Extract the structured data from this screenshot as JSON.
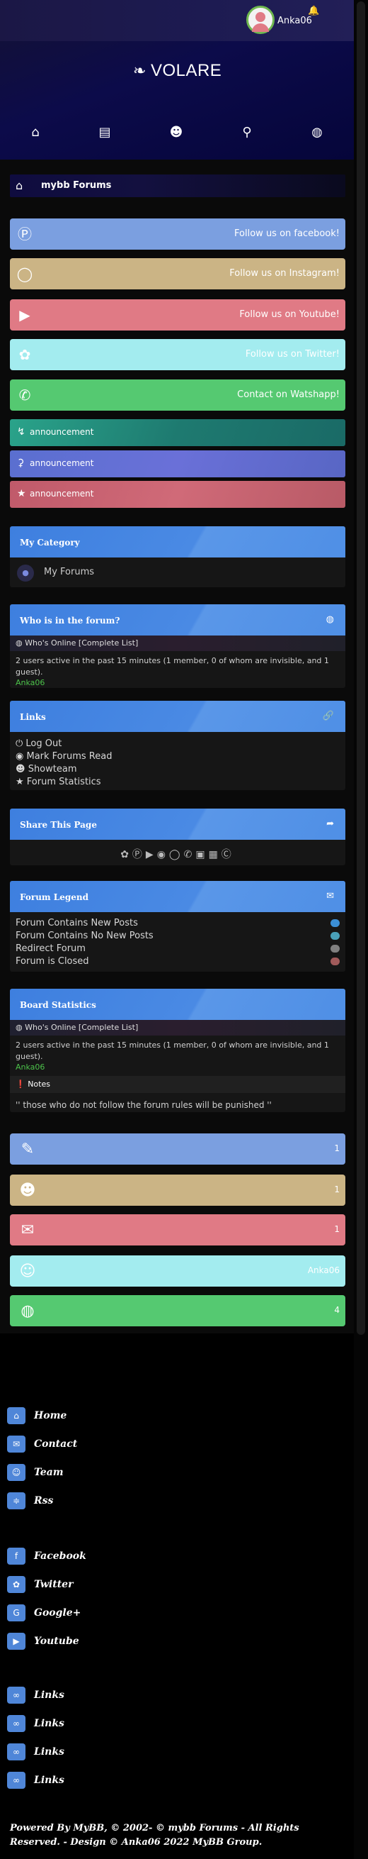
{
  "header": {
    "username": "Anka06",
    "logo_text": "VOLARE",
    "nav": [
      {
        "icon": "home-icon",
        "glyph": "⌂"
      },
      {
        "icon": "chart-icon",
        "glyph": "▤"
      },
      {
        "icon": "users-icon",
        "glyph": "☻"
      },
      {
        "icon": "search-icon",
        "glyph": "⚲"
      },
      {
        "icon": "globe-icon",
        "glyph": "◍"
      }
    ]
  },
  "breadcrumb": {
    "label": "mybb Forums"
  },
  "social": [
    {
      "label": "Follow us on facebook!",
      "icon": "facebook-icon",
      "color": "#7b9fe0"
    },
    {
      "label": "Follow us on Instagram!",
      "icon": "instagram-icon",
      "color": "#cbb485"
    },
    {
      "label": "Follow us on Youtube!",
      "icon": "youtube-icon",
      "color": "#e07a85"
    },
    {
      "label": "Follow us on Twitter!",
      "icon": "twitter-icon",
      "color": "#a3ecef"
    },
    {
      "label": "Contact on Watshapp!",
      "icon": "whatsapp-icon",
      "color": "#55c971"
    }
  ],
  "announcements": [
    {
      "label": "announcement",
      "icon": "bolt-icon"
    },
    {
      "label": "announcement",
      "icon": "bell-icon"
    },
    {
      "label": "announcement",
      "icon": "award-icon"
    }
  ],
  "category": {
    "title": "My Category",
    "forum": "My Forums"
  },
  "who": {
    "title": "Who is in the forum?",
    "online_label": "Who's Online [Complete List]",
    "stats": "2 users active in the past 15 minutes (1 member, 0 of whom are invisible, and 1 guest).",
    "member": "Anka06"
  },
  "links": {
    "title": "Links",
    "items": [
      "Log Out",
      "Mark Forums Read",
      "Showteam",
      "Forum Statistics"
    ]
  },
  "share": {
    "title": "Share This Page"
  },
  "legend": {
    "title": "Forum Legend",
    "items": [
      {
        "label": "Forum Contains New Posts",
        "color": "#3b8fd6"
      },
      {
        "label": "Forum Contains No New Posts",
        "color": "#4aa0b8"
      },
      {
        "label": "Redirect Forum",
        "color": "#808080"
      },
      {
        "label": "Forum is Closed",
        "color": "#a05a5a"
      }
    ]
  },
  "board": {
    "title": "Board Statistics",
    "online_label": "Who's Online [Complete List]",
    "stats": "2 users active in the past 15 minutes (1 member, 0 of whom are invisible, and 1 guest).",
    "member": "Anka06",
    "notes_title": "Notes",
    "notes_text": "'' those who do not follow the forum rules will be punished ''"
  },
  "stat_boxes": [
    {
      "value": "1",
      "icon": "pencil-icon",
      "color": "#7b9fe0"
    },
    {
      "value": "1",
      "icon": "users-icon",
      "color": "#cbb485"
    },
    {
      "value": "1",
      "icon": "comments-icon",
      "color": "#e07a85"
    },
    {
      "value": "Anka06",
      "icon": "user-plus-icon",
      "color": "#a3ecef"
    },
    {
      "value": "4",
      "icon": "globe-icon",
      "color": "#55c971"
    }
  ],
  "footer": {
    "nav": [
      {
        "label": "Home",
        "icon": "home-icon"
      },
      {
        "label": "Contact",
        "icon": "envelope-icon"
      },
      {
        "label": "Team",
        "icon": "user-icon"
      },
      {
        "label": "Rss",
        "icon": "rss-icon"
      }
    ],
    "social": [
      {
        "label": "Facebook",
        "icon": "facebook-icon"
      },
      {
        "label": "Twitter",
        "icon": "twitter-icon"
      },
      {
        "label": "Google+",
        "icon": "google-plus-icon"
      },
      {
        "label": "Youtube",
        "icon": "youtube-icon"
      }
    ],
    "links": [
      {
        "label": "Links",
        "icon": "link-icon"
      },
      {
        "label": "Links",
        "icon": "link-icon"
      },
      {
        "label": "Links",
        "icon": "link-icon"
      },
      {
        "label": "Links",
        "icon": "link-icon"
      }
    ],
    "copyright": "Powered By MyBB, © 2002- © mybb Forums - All Rights Reserved. - Design © Anka06 2022 MyBB Group."
  }
}
